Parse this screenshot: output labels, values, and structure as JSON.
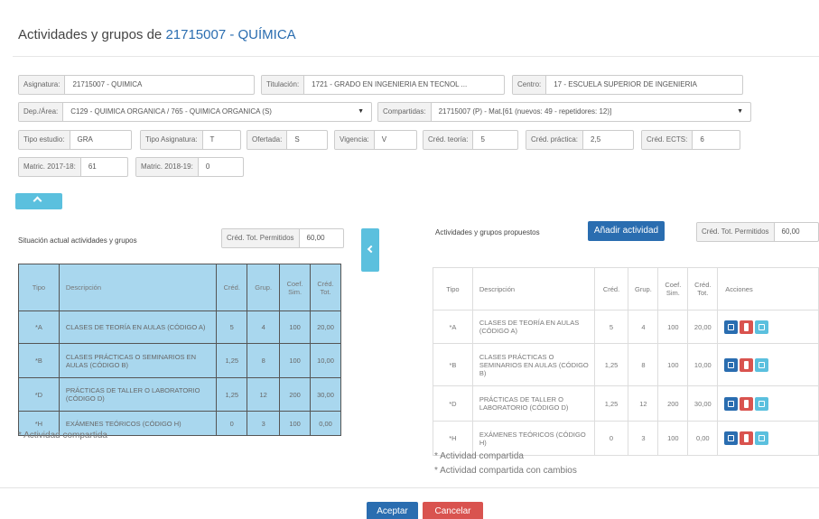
{
  "header": {
    "title_prefix": "Actividades y grupos de",
    "title_code": "21715007 - QUÍMICA"
  },
  "fields": {
    "asignatura": {
      "label": "Asignatura:",
      "value": "21715007 - QUIMICA"
    },
    "titulacion": {
      "label": "Titulación:",
      "value": "1721 - GRADO EN INGENIERIA EN TECNOL ..."
    },
    "centro": {
      "label": "Centro:",
      "value": "17 - ESCUELA SUPERIOR DE INGENIERIA"
    },
    "dep_area": {
      "label": "Dep./Área:",
      "value": "C129 - QUIMICA ORGANICA / 765 - QUIMICA ORGANICA (S)"
    },
    "compartidas": {
      "label": "Compartidas:",
      "value": "21715007 (P) - Mat.[61 (nuevos: 49 - repetidores: 12)]"
    },
    "tipo_estudio": {
      "label": "Tipo estudio:",
      "value": "GRA"
    },
    "tipo_asignatura": {
      "label": "Tipo Asignatura:",
      "value": "T"
    },
    "ofertada": {
      "label": "Ofertada:",
      "value": "S"
    },
    "vigencia": {
      "label": "Vigencia:",
      "value": "V"
    },
    "cred_teoria": {
      "label": "Créd. teoría:",
      "value": "5"
    },
    "cred_practica": {
      "label": "Créd. práctica:",
      "value": "2,5"
    },
    "cred_ects": {
      "label": "Créd. ECTS:",
      "value": "6"
    },
    "matric_2017": {
      "label": "Matric. 2017-18:",
      "value": "61"
    },
    "matric_2018": {
      "label": "Matric. 2018-19:",
      "value": "0"
    }
  },
  "left": {
    "title": "Situación actual actividades y grupos",
    "cred_label": "Créd. Tot. Permitidos",
    "cred_value": "60,00",
    "headers": {
      "tipo": "Tipo",
      "desc": "Descripción",
      "cred": "Créd.",
      "grup": "Grup.",
      "coef1": "Coef.",
      "coef2": "Sim.",
      "tot1": "Créd.",
      "tot2": "Tot."
    },
    "rows": [
      {
        "tipo": "*A",
        "desc": "CLASES DE TEORÍA EN AULAS (CÓDIGO A)",
        "cred": "5",
        "grup": "4",
        "coef": "100",
        "tot": "20,00"
      },
      {
        "tipo": "*B",
        "desc": "CLASES PRÁCTICAS O SEMINARIOS EN AULAS (CÓDIGO B)",
        "cred": "1,25",
        "grup": "8",
        "coef": "100",
        "tot": "10,00"
      },
      {
        "tipo": "*D",
        "desc": "PRÁCTICAS DE TALLER O LABORATORIO (CÓDIGO D)",
        "cred": "1,25",
        "grup": "12",
        "coef": "200",
        "tot": "30,00"
      },
      {
        "tipo": "*H",
        "desc": "EXÁMENES TEÓRICOS (CÓDIGO H)",
        "cred": "0",
        "grup": "3",
        "coef": "100",
        "tot": "0,00"
      }
    ],
    "note": "* Actividad compartida"
  },
  "right": {
    "title": "Actividades y grupos propuestos",
    "add_button": "Añadir actividad",
    "cred_label": "Créd. Tot. Permitidos",
    "cred_value": "60,00",
    "headers": {
      "tipo": "Tipo",
      "desc": "Descripción",
      "cred": "Créd.",
      "grup": "Grup.",
      "coef1": "Coef.",
      "coef2": "Sim.",
      "tot1": "Créd.",
      "tot2": "Tot.",
      "acciones": "Acciones"
    },
    "rows": [
      {
        "tipo": "*A",
        "desc": "CLASES DE TEORÍA EN AULAS (CÓDIGO A)",
        "cred": "5",
        "grup": "4",
        "coef": "100",
        "tot": "20,00"
      },
      {
        "tipo": "*B",
        "desc": "CLASES PRÁCTICAS O SEMINARIOS EN AULAS (CÓDIGO B)",
        "cred": "1,25",
        "grup": "8",
        "coef": "100",
        "tot": "10,00"
      },
      {
        "tipo": "*D",
        "desc": "PRÁCTICAS DE TALLER O LABORATORIO (CÓDIGO D)",
        "cred": "1,25",
        "grup": "12",
        "coef": "200",
        "tot": "30,00"
      },
      {
        "tipo": "*H",
        "desc": "EXÁMENES TEÓRICOS (CÓDIGO H)",
        "cred": "0",
        "grup": "3",
        "coef": "100",
        "tot": "0,00"
      }
    ],
    "note1": "* Actividad compartida",
    "note2": "* Actividad compartida con cambios"
  },
  "footer": {
    "accept": "Aceptar",
    "cancel": "Cancelar"
  },
  "colors": {
    "primary": "#2a6db0",
    "info": "#5bc0de",
    "danger": "#d9534f",
    "table_fill": "#a9d7ee"
  },
  "icons": {
    "edit": "edit-icon",
    "delete": "trash-icon",
    "copy": "copy-icon",
    "collapse": "chevron-up-icon",
    "toggle": "chevron-left-icon",
    "dropdown": "caret-down-icon"
  }
}
